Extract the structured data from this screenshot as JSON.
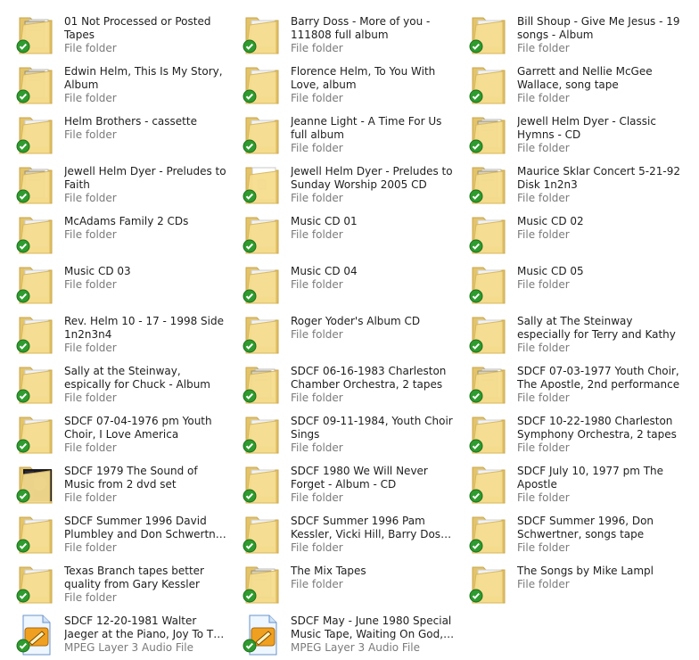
{
  "items": [
    {
      "name": "01 Not Processed or Posted Tapes",
      "type": "File folder",
      "thumb": "docs"
    },
    {
      "name": "Barry Doss - More of you - 111808 full album",
      "type": "File folder",
      "thumb": "empty"
    },
    {
      "name": "Bill Shoup - Give Me Jesus - 19 songs - Album",
      "type": "File folder",
      "thumb": "empty"
    },
    {
      "name": "Edwin Helm, This Is My Story, Album",
      "type": "File folder",
      "thumb": "docs"
    },
    {
      "name": "Florence Helm, To You With Love, album",
      "type": "File folder",
      "thumb": "empty"
    },
    {
      "name": "Garrett and Nellie McGee Wallace, song tape",
      "type": "File folder",
      "thumb": "empty"
    },
    {
      "name": "Helm Brothers - cassette",
      "type": "File folder",
      "thumb": "empty"
    },
    {
      "name": "Jeanne Light - A Time For Us full album",
      "type": "File folder",
      "thumb": "empty"
    },
    {
      "name": "Jewell Helm Dyer - Classic Hymns - CD",
      "type": "File folder",
      "thumb": "docs"
    },
    {
      "name": "Jewell Helm Dyer - Preludes to Faith",
      "type": "File folder",
      "thumb": "docs"
    },
    {
      "name": "Jewell Helm Dyer - Preludes to Sunday Worship 2005 CD",
      "type": "File folder",
      "thumb": "paper"
    },
    {
      "name": "Maurice Sklar Concert 5-21-92 Disk 1n2n3",
      "type": "File folder",
      "thumb": "docs"
    },
    {
      "name": "McAdams Family 2 CDs",
      "type": "File folder",
      "thumb": "empty"
    },
    {
      "name": "Music CD 01",
      "type": "File folder",
      "thumb": "empty"
    },
    {
      "name": "Music CD 02",
      "type": "File folder",
      "thumb": "empty"
    },
    {
      "name": "Music CD 03",
      "type": "File folder",
      "thumb": "empty"
    },
    {
      "name": "Music CD 04",
      "type": "File folder",
      "thumb": "empty"
    },
    {
      "name": "Music CD 05",
      "type": "File folder",
      "thumb": "empty"
    },
    {
      "name": "Rev. Helm 10 - 17 - 1998 Side 1n2n3n4",
      "type": "File folder",
      "thumb": "empty"
    },
    {
      "name": "Roger Yoder's Album CD",
      "type": "File folder",
      "thumb": "empty"
    },
    {
      "name": "Sally at The Steinway especially for Terry and Kathy",
      "type": "File folder",
      "thumb": "empty"
    },
    {
      "name": "Sally at the Steinway, espically for Chuck - Album",
      "type": "File folder",
      "thumb": "empty"
    },
    {
      "name": "SDCF 06-16-1983 Charleston Chamber Orchestra, 2 tapes",
      "type": "File folder",
      "thumb": "docs"
    },
    {
      "name": "SDCF 07-03-1977 Youth Choir, The Apostle, 2nd performance",
      "type": "File folder",
      "thumb": "docs"
    },
    {
      "name": "SDCF 07-04-1976 pm Youth Choir, I Love America",
      "type": "File folder",
      "thumb": "empty"
    },
    {
      "name": "SDCF 09-11-1984, Youth Choir Sings",
      "type": "File folder",
      "thumb": "empty"
    },
    {
      "name": "SDCF 10-22-1980 Charleston Symphony Orchestra, 2 tapes",
      "type": "File folder",
      "thumb": "empty"
    },
    {
      "name": "SDCF 1979 The Sound of Music from 2 dvd set",
      "type": "File folder",
      "thumb": "dark"
    },
    {
      "name": "SDCF 1980 We Will Never Forget - Album - CD",
      "type": "File folder",
      "thumb": "empty"
    },
    {
      "name": "SDCF July 10, 1977 pm The Apostle",
      "type": "File folder",
      "thumb": "empty"
    },
    {
      "name": "SDCF Summer 1996 David Plumbley and Don Schwertner, so...",
      "type": "File folder",
      "thumb": "empty"
    },
    {
      "name": "SDCF Summer 1996 Pam Kessler, Vicki Hill, Barry Doss, Songs",
      "type": "File folder",
      "thumb": "empty"
    },
    {
      "name": "SDCF Summer 1996, Don Schwertner, songs tape",
      "type": "File folder",
      "thumb": "empty"
    },
    {
      "name": "Texas Branch tapes better quality from Gary Kessler",
      "type": "File folder",
      "thumb": "empty"
    },
    {
      "name": "The Mix Tapes",
      "type": "File folder",
      "thumb": "docs"
    },
    {
      "name": "The Songs by Mike Lampl",
      "type": "File folder",
      "thumb": "empty"
    },
    {
      "name": "SDCF 12-20-1981 Walter Jaeger at the Piano, Joy To The World, full t...",
      "type": "MPEG Layer 3 Audio File",
      "thumb": "mp3"
    },
    {
      "name": "SDCF May - June 1980 Special Music Tape, Waiting On God, Pia...",
      "type": "MPEG Layer 3 Audio File",
      "thumb": "mp3"
    }
  ],
  "colors": {
    "folder_back": "#e3c46a",
    "folder_front": "#f6dd8e",
    "check": "#2e9b2e",
    "mp3_orange": "#f0a020"
  }
}
